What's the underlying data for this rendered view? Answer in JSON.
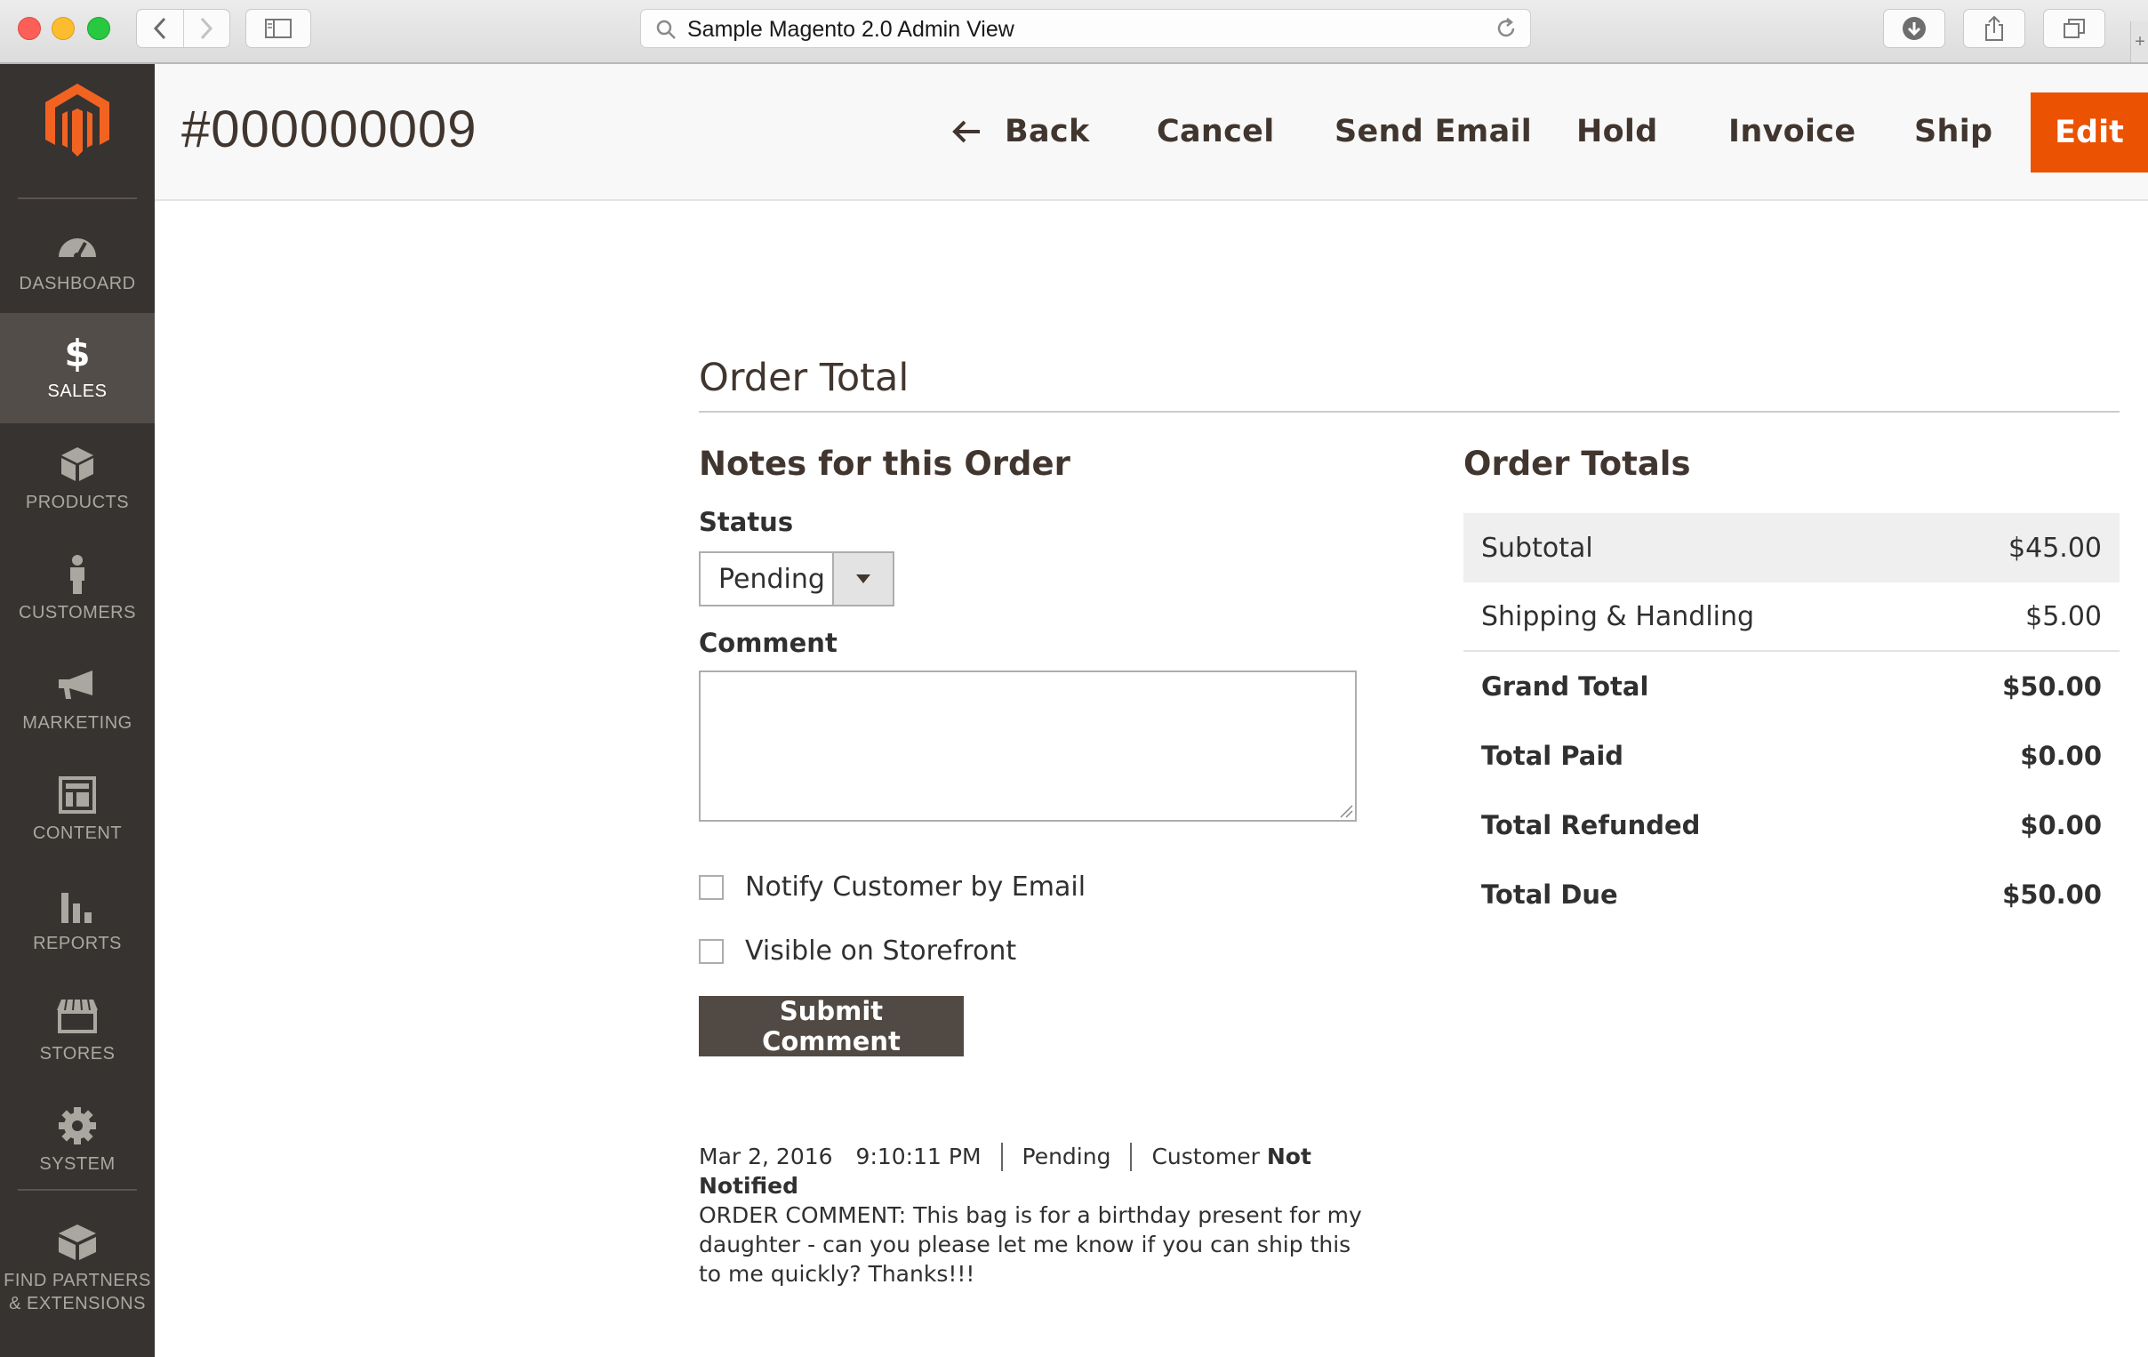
{
  "browser": {
    "url_text": "Sample Magento 2.0 Admin View"
  },
  "sidebar": {
    "items": [
      {
        "label": "DASHBOARD",
        "icon": "dashboard-gauge-icon"
      },
      {
        "label": "SALES",
        "icon": "dollar-icon",
        "active": true
      },
      {
        "label": "PRODUCTS",
        "icon": "cube-icon"
      },
      {
        "label": "CUSTOMERS",
        "icon": "person-icon"
      },
      {
        "label": "MARKETING",
        "icon": "megaphone-icon"
      },
      {
        "label": "CONTENT",
        "icon": "layout-icon"
      },
      {
        "label": "REPORTS",
        "icon": "bar-chart-icon"
      },
      {
        "label": "STORES",
        "icon": "storefront-icon"
      },
      {
        "label": "SYSTEM",
        "icon": "gear-icon"
      },
      {
        "label_line1": "FIND PARTNERS",
        "label_line2": "& EXTENSIONS",
        "icon": "boxes-icon"
      }
    ]
  },
  "header": {
    "order_id": "#000000009",
    "actions": {
      "back": "Back",
      "cancel": "Cancel",
      "send_email": "Send Email",
      "hold": "Hold",
      "invoice": "Invoice",
      "ship": "Ship",
      "edit": "Edit"
    }
  },
  "order_total": {
    "section_title": "Order Total",
    "notes": {
      "title": "Notes for this Order",
      "status_label": "Status",
      "status_value": "Pending",
      "comment_label": "Comment",
      "comment_value": "",
      "notify_label": "Notify Customer by Email",
      "visible_label": "Visible on Storefront",
      "submit_label": "Submit Comment"
    },
    "history": {
      "date": "Mar 2, 2016",
      "time": "9:10:11 PM",
      "status": "Pending",
      "customer_prefix": "Customer",
      "customer_not": "Not",
      "notified": "Notified",
      "comment": "ORDER COMMENT: This bag is for a birthday present for my daughter - can you please let me know if you can ship this to me quickly? Thanks!!!"
    },
    "totals": {
      "title": "Order Totals",
      "rows": [
        {
          "label": "Subtotal",
          "value": "$45.00"
        },
        {
          "label": "Shipping & Handling",
          "value": "$5.00"
        },
        {
          "label": "Grand Total",
          "value": "$50.00"
        },
        {
          "label": "Total Paid",
          "value": "$0.00"
        },
        {
          "label": "Total Refunded",
          "value": "$0.00"
        },
        {
          "label": "Total Due",
          "value": "$50.00"
        }
      ]
    }
  },
  "colors": {
    "sidebar_bg": "#373330",
    "sidebar_active": "#524d49",
    "accent_orange": "#eb5202",
    "submit_bg": "#514943"
  }
}
